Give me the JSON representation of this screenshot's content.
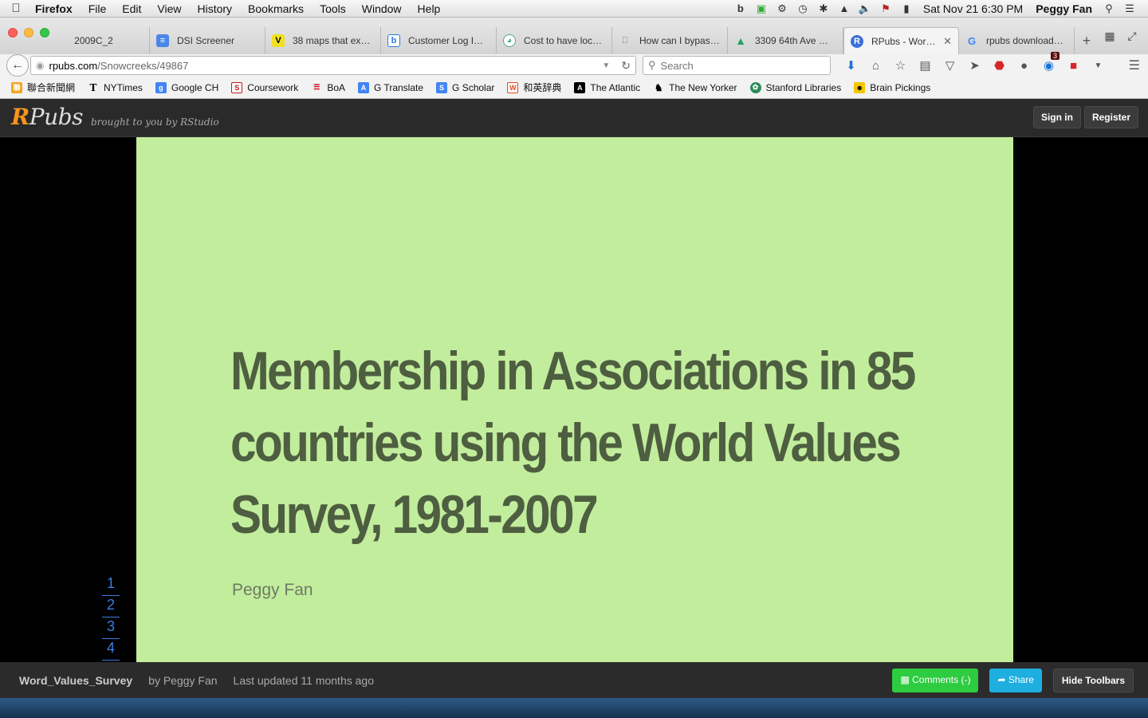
{
  "menubar": {
    "app": "Firefox",
    "items": [
      "File",
      "Edit",
      "View",
      "History",
      "Bookmarks",
      "Tools",
      "Window",
      "Help"
    ],
    "clock": "Sat Nov 21  6:30 PM",
    "user": "Peggy Fan"
  },
  "tabs": [
    {
      "label": "2009C_2",
      "icon": "none"
    },
    {
      "label": "DSI Screener",
      "icon": "google-docs-icon",
      "color": "#4a86e8"
    },
    {
      "label": "38 maps that ex…",
      "icon": "vox-icon",
      "color": "#f0e020"
    },
    {
      "label": "Customer Log I…",
      "icon": "b-icon",
      "color": "#2a7ae2"
    },
    {
      "label": "Cost to have loc…",
      "icon": "gauge-icon",
      "color": "#6c9"
    },
    {
      "label": "How can I bypas…",
      "icon": "apple-icon",
      "color": "#888"
    },
    {
      "label": "3309 64th Ave …",
      "icon": "google-drive-icon",
      "color": "#1fa463"
    },
    {
      "label": "RPubs - Wor…",
      "icon": "rpubs-icon",
      "color": "#3a6fd8",
      "active": true
    },
    {
      "label": "rpubs download…",
      "icon": "google-icon",
      "color": "#4285f4"
    }
  ],
  "navbar": {
    "url_host": "rpubs.com",
    "url_path": "/Snowcreeks/49867",
    "search_placeholder": "Search",
    "badge": "3"
  },
  "bookmarks": [
    {
      "label": "聯合新聞網",
      "color": "#f5a623"
    },
    {
      "label": "NYTimes",
      "color": "#000"
    },
    {
      "label": "Google CH",
      "color": "#4285f4"
    },
    {
      "label": "Coursework",
      "color": "#c4161c"
    },
    {
      "label": "BoA",
      "color": "#d4001a"
    },
    {
      "label": "G Translate",
      "color": "#4285f4"
    },
    {
      "label": "G Scholar",
      "color": "#4285f4"
    },
    {
      "label": "和英辞典",
      "color": "#e24a1b"
    },
    {
      "label": "The Atlantic",
      "color": "#000"
    },
    {
      "label": "The New Yorker",
      "color": "#000"
    },
    {
      "label": "Stanford Libraries",
      "color": "#2e8b57"
    },
    {
      "label": "Brain Pickings",
      "color": "#f2c500"
    }
  ],
  "rpubs": {
    "logo_r": "R",
    "logo_rest": "Pubs",
    "tagline": "brought to you by RStudio",
    "sign_in": "Sign in",
    "register": "Register"
  },
  "slide": {
    "title": "Membership in Associations in 85 countries using the World Values Survey, 1981-2007",
    "author": "Peggy Fan",
    "nav": [
      "1",
      "2",
      "3",
      "4"
    ]
  },
  "footer": {
    "doc_name": "Word_Values_Survey",
    "by": "by Peggy Fan",
    "updated": "Last updated 11 months ago",
    "comments": "Comments (-)",
    "share": "Share",
    "hide": "Hide Toolbars"
  }
}
